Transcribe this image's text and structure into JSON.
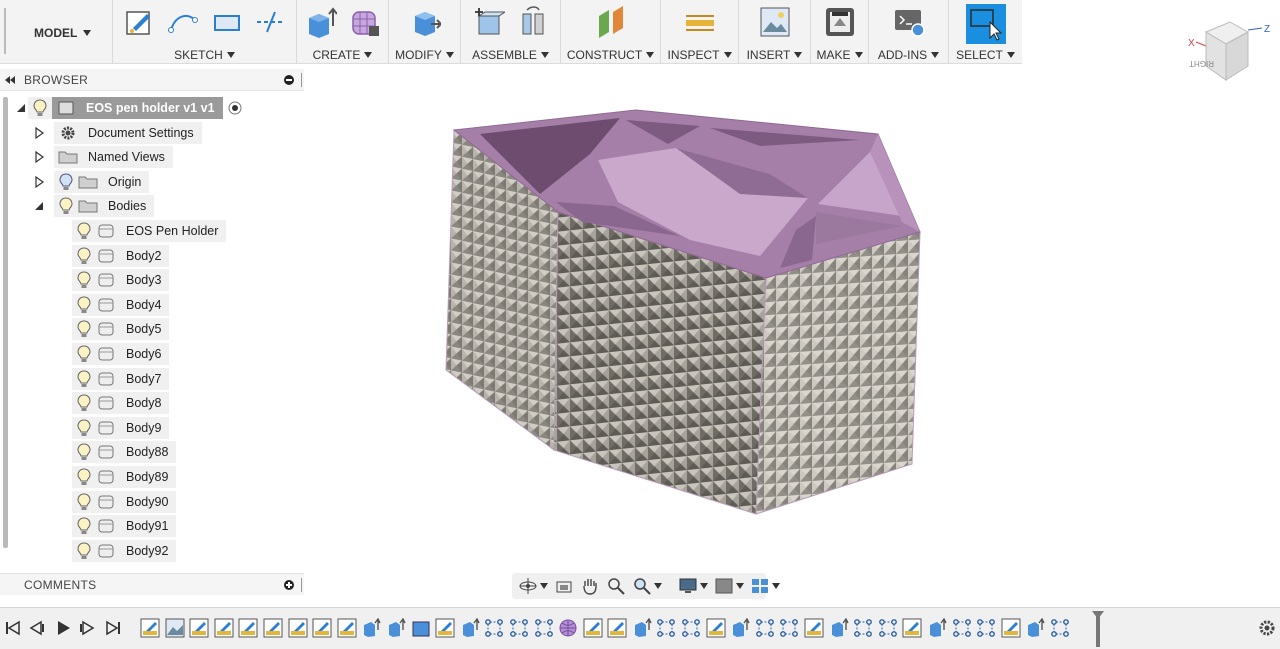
{
  "toolbar": {
    "workspace": "MODEL",
    "groups": [
      {
        "label": "SKETCH",
        "icons": [
          "create-sketch-icon",
          "arc-icon",
          "rectangle-icon",
          "trim-icon"
        ]
      },
      {
        "label": "CREATE",
        "icons": [
          "extrude-icon",
          "form-icon"
        ]
      },
      {
        "label": "MODIFY",
        "icons": [
          "press-pull-icon"
        ]
      },
      {
        "label": "ASSEMBLE",
        "icons": [
          "new-component-icon",
          "joint-icon"
        ]
      },
      {
        "label": "CONSTRUCT",
        "icons": [
          "offset-plane-icon"
        ]
      },
      {
        "label": "INSPECT",
        "icons": [
          "measure-icon"
        ]
      },
      {
        "label": "INSERT",
        "icons": [
          "insert-image-icon"
        ]
      },
      {
        "label": "MAKE",
        "icons": [
          "3d-print-icon"
        ]
      },
      {
        "label": "ADD-INS",
        "icons": [
          "scripts-icon"
        ]
      },
      {
        "label": "SELECT",
        "icons": [
          "select-icon"
        ]
      }
    ],
    "colors": {
      "select_active": "#1a8fe0",
      "sketch_icon": "#2a7fd4",
      "create_icon": "#4a90d9",
      "form_icon": "#8a5fb0",
      "construct_icon": "#d98a2a",
      "inspect_icon": "#e5b53a"
    }
  },
  "browser": {
    "title": "BROWSER",
    "root": {
      "label": "EOS pen holder v1 v1"
    },
    "folders": [
      {
        "label": "Document Settings",
        "icon": "gear-icon",
        "has_bulb": false,
        "expanded": false
      },
      {
        "label": "Named Views",
        "icon": "folder-icon",
        "has_bulb": false,
        "expanded": false
      },
      {
        "label": "Origin",
        "icon": "folder-icon",
        "has_bulb": true,
        "expanded": false
      },
      {
        "label": "Bodies",
        "icon": "folder-icon",
        "has_bulb": true,
        "expanded": true
      }
    ],
    "bodies": [
      "EOS Pen Holder",
      "Body2",
      "Body3",
      "Body4",
      "Body5",
      "Body6",
      "Body7",
      "Body8",
      "Body9",
      "Body88",
      "Body89",
      "Body90",
      "Body91",
      "Body92"
    ]
  },
  "viewcube": {
    "face": "RIGHT",
    "axis_x": "X",
    "axis_z": "Z",
    "colors": {
      "x_axis": "#e04040",
      "z_axis": "#3060d0"
    }
  },
  "comments": {
    "title": "COMMENTS"
  },
  "navbar": {
    "icons": [
      "orbit-icon",
      "look-at-icon",
      "pan-icon",
      "zoom-icon",
      "zoom-window-icon",
      "display-settings-icon",
      "grid-icon",
      "viewports-icon"
    ]
  },
  "timeline": {
    "controls": [
      "go-to-start-icon",
      "step-back-icon",
      "play-icon",
      "step-forward-icon",
      "go-to-end-icon"
    ],
    "features": [
      "sketch",
      "image",
      "sketch",
      "sketch",
      "sketch",
      "sketch",
      "sketch",
      "sketch",
      "sketch",
      "extrude",
      "extrude",
      "body",
      "sketch",
      "extrude",
      "pattern",
      "pattern",
      "pattern",
      "form",
      "sketch",
      "sketch",
      "extrude",
      "pattern",
      "pattern",
      "sketch",
      "extrude",
      "pattern",
      "pattern",
      "sketch",
      "extrude",
      "pattern",
      "pattern",
      "sketch",
      "extrude",
      "pattern",
      "pattern",
      "sketch",
      "extrude",
      "pattern"
    ]
  },
  "model": {
    "colors": {
      "top_face": "#a57fa8",
      "wall_inner": "#c9a8cc",
      "side_front": "#8e8b84",
      "side_left": "#9b9890",
      "side_right": "#a3a098"
    }
  }
}
